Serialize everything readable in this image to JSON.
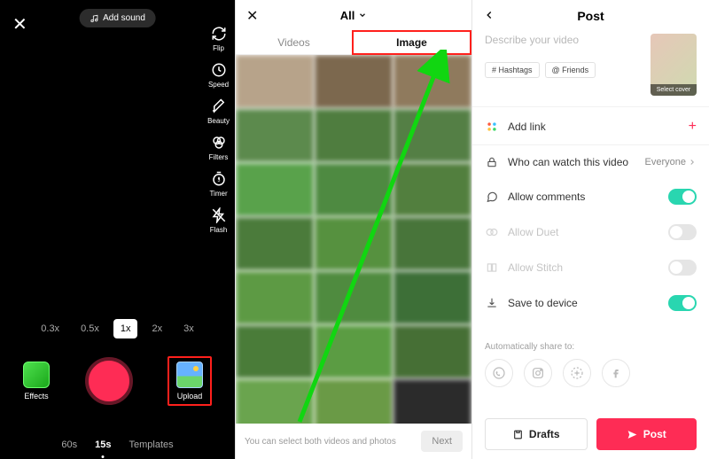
{
  "camera": {
    "add_sound": "Add sound",
    "sidebar": [
      {
        "icon": "flip-icon",
        "label": "Flip"
      },
      {
        "icon": "speed-icon",
        "label": "Speed"
      },
      {
        "icon": "beauty-icon",
        "label": "Beauty"
      },
      {
        "icon": "filters-icon",
        "label": "Filters"
      },
      {
        "icon": "timer-icon",
        "label": "Timer"
      },
      {
        "icon": "flash-icon",
        "label": "Flash"
      }
    ],
    "zoom": [
      "0.3x",
      "0.5x",
      "1x",
      "2x",
      "3x"
    ],
    "zoom_active": "1x",
    "effects_label": "Effects",
    "upload_label": "Upload",
    "modes": [
      "60s",
      "15s",
      "Templates"
    ],
    "mode_active": "15s"
  },
  "picker": {
    "title": "All",
    "tabs": {
      "videos": "Videos",
      "image": "Image"
    },
    "active_tab": "Image",
    "hint": "You can select both videos and photos",
    "next": "Next",
    "cell_colors": [
      "#b7a38a",
      "#7c684e",
      "#8f7a5d",
      "#5c8a4d",
      "#4f7d3f",
      "#547f45",
      "#59a24b",
      "#4e8a41",
      "#527f3e",
      "#4b7b3b",
      "#56913f",
      "#48753a",
      "#5d9a44",
      "#4f8b3f",
      "#3d6f37",
      "#4a7c39",
      "#5b9c43",
      "#466f35",
      "#6aa44e",
      "#6a9a46",
      "#2b2b2b"
    ]
  },
  "post": {
    "title": "Post",
    "placeholder": "Describe your video",
    "cover_label": "Select cover",
    "chips": {
      "hashtags": "# Hashtags",
      "friends": "@ Friends"
    },
    "rows": {
      "addlink": "Add link",
      "privacy_label": "Who can watch this video",
      "privacy_value": "Everyone",
      "comments": "Allow comments",
      "duet": "Allow Duet",
      "stitch": "Allow Stitch",
      "save": "Save to device"
    },
    "toggles": {
      "comments": true,
      "duet": false,
      "stitch": false,
      "save": true
    },
    "share_label": "Automatically share to:",
    "drafts": "Drafts",
    "post": "Post"
  }
}
